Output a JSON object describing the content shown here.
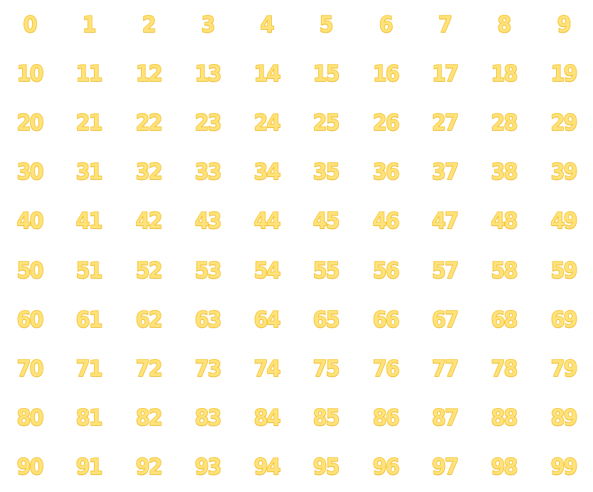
{
  "numbers": [
    "0",
    "1",
    "2",
    "3",
    "4",
    "5",
    "6",
    "7",
    "8",
    "9",
    "10",
    "11",
    "12",
    "13",
    "14",
    "15",
    "16",
    "17",
    "18",
    "19",
    "20",
    "21",
    "22",
    "23",
    "24",
    "25",
    "26",
    "27",
    "28",
    "29",
    "30",
    "31",
    "32",
    "33",
    "34",
    "35",
    "36",
    "37",
    "38",
    "39",
    "40",
    "41",
    "42",
    "43",
    "44",
    "45",
    "46",
    "47",
    "48",
    "49",
    "50",
    "51",
    "52",
    "53",
    "54",
    "55",
    "56",
    "57",
    "58",
    "59",
    "60",
    "61",
    "62",
    "63",
    "64",
    "65",
    "66",
    "67",
    "68",
    "69",
    "70",
    "71",
    "72",
    "73",
    "74",
    "75",
    "76",
    "77",
    "78",
    "79",
    "80",
    "81",
    "82",
    "83",
    "84",
    "85",
    "86",
    "87",
    "88",
    "89",
    "90",
    "91",
    "92",
    "93",
    "94",
    "95",
    "96",
    "97",
    "98",
    "99"
  ],
  "colors": {
    "fill": "#ffe27a",
    "outline": "#f2bb14",
    "background": "#ffffff"
  }
}
